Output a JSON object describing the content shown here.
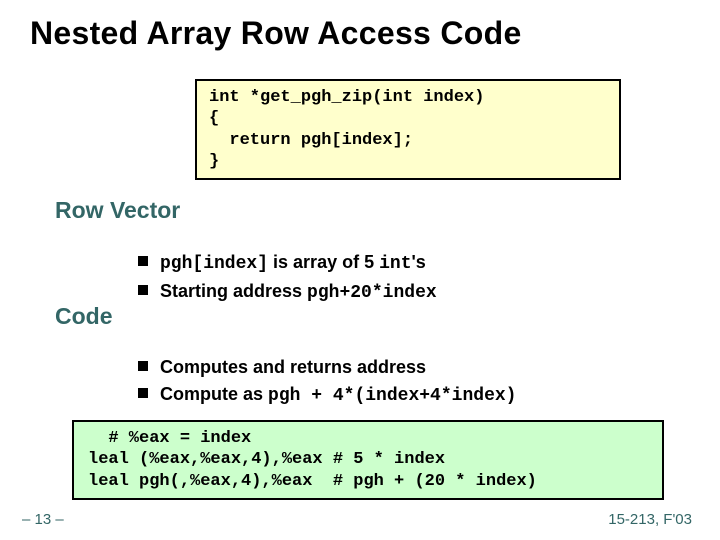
{
  "title": "Nested Array Row Access Code",
  "code1": "int *get_pgh_zip(int index)\n{\n  return pgh[index];\n}",
  "section1": "Row Vector",
  "bullets1": {
    "b1_a": "pgh[index]",
    "b1_b": " is array of 5 ",
    "b1_c": "int",
    "b1_d": "'s",
    "b2_a": "Starting address ",
    "b2_b": "pgh+20*index"
  },
  "section2": "Code",
  "bullets2": {
    "b1": "Computes and returns address",
    "b2_a": "Compute as ",
    "b2_b": "pgh + 4*(index+4*index)"
  },
  "code2": "  # %eax = index\nleal (%eax,%eax,4),%eax # 5 * index\nleal pgh(,%eax,4),%eax  # pgh + (20 * index)",
  "footer_left": "– 13 –",
  "footer_right": "15-213, F'03"
}
